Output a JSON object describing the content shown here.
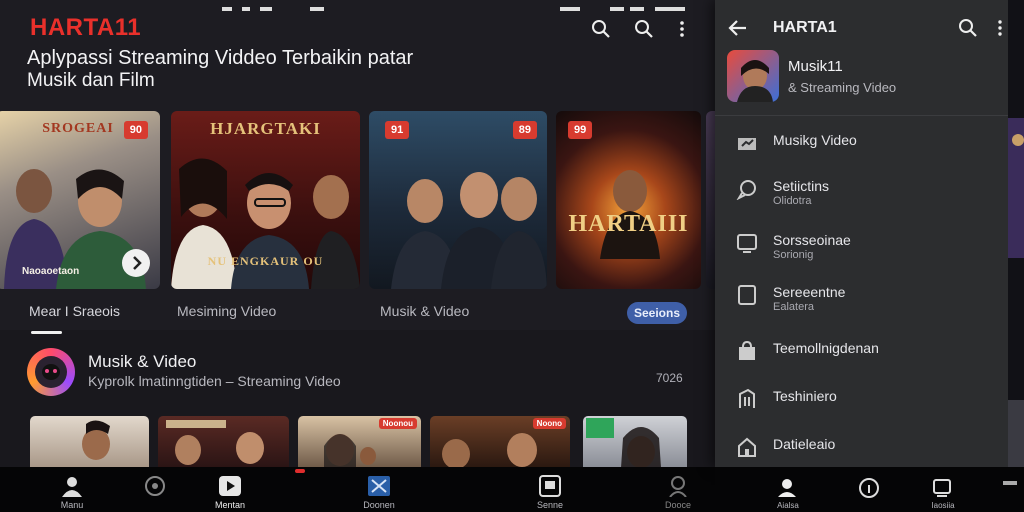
{
  "app": {
    "logo": "HARTA11",
    "headline": "Aplypassi Streaming Viddeo Terbaikin patar",
    "subline": "Musik dan Film"
  },
  "carousel": [
    {
      "title": "SROGEAI",
      "badge": "90",
      "caption": "Naoaoetaon"
    },
    {
      "title": "HJARGTAKI",
      "badge": "",
      "caption": "NU ENGKAUR OU"
    },
    {
      "title": "",
      "badge": "91",
      "badge2": "89",
      "caption": ""
    },
    {
      "title": "HARTAIII",
      "badge": "99",
      "caption": ""
    }
  ],
  "tabs": {
    "tab1": "Mear I Sraeois",
    "tab2": "Mesiming Video",
    "tab3": "Musik & Video",
    "pill": "Seeions"
  },
  "section": {
    "title": "Musik & Video",
    "subtitle": "Kyprolk lmatinngtiden – Streaming Video",
    "number": "7026"
  },
  "thumbs": [
    {
      "badge": ""
    },
    {
      "badge": ""
    },
    {
      "badge": "Noonou"
    },
    {
      "badge": "Noono"
    },
    {
      "badge": ""
    }
  ],
  "bottom_nav": [
    {
      "label": "Manu",
      "icon": "home-icon"
    },
    {
      "label": "",
      "icon": "music-icon"
    },
    {
      "label": "Mentan",
      "icon": "play-icon"
    },
    {
      "label": "Doonen",
      "icon": "video-icon"
    },
    {
      "label": "Senne",
      "icon": "tv-icon"
    },
    {
      "label": "Dooce",
      "icon": "profile-icon"
    }
  ],
  "drawer": {
    "title": "HARTA1",
    "profile_name": "Musik11",
    "profile_sub": "& Streaming Video",
    "items": [
      {
        "label": "Musikg Video",
        "sub": "",
        "icon": "video-icon"
      },
      {
        "label": "Setiictins",
        "sub": "Olidotra",
        "icon": "chat-icon"
      },
      {
        "label": "Sorsseoinae",
        "sub": "Sorionig",
        "icon": "tv-icon"
      },
      {
        "label": "Sereeentne",
        "sub": "Ealatera",
        "icon": "tablet-icon"
      },
      {
        "label": "Teemollnigdenan",
        "sub": "",
        "icon": "bag-icon"
      },
      {
        "label": "Teshiniero",
        "sub": "",
        "icon": "building-icon"
      },
      {
        "label": "Datieleaio",
        "sub": "",
        "icon": "home-icon"
      }
    ],
    "nav": [
      {
        "label": "Aialsa",
        "icon": "profile-icon"
      },
      {
        "label": "",
        "icon": "info-icon"
      },
      {
        "label": "Iaosiia",
        "icon": "list-icon"
      }
    ]
  },
  "colors": {
    "accent": "#e9302b",
    "pill": "#3f5fa8",
    "drawer": "#2c2d2f"
  }
}
